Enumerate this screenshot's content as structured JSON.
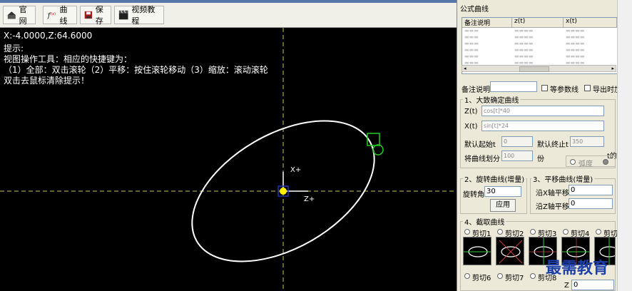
{
  "toolbar": {
    "home_label": "官网",
    "curve_label": "曲线",
    "save_label": "保存",
    "video_label": "视频教程"
  },
  "canvas": {
    "coords": "X:-4.0000,Z:64.6000",
    "hint_title": "提示:",
    "hint_line1": "视图操作工具：相应的快捷键为：",
    "hint_line2": "（1）全部：双击滚轮（2）平移：按住滚轮移动（3）缩放：滚动滚轮",
    "hint_line3": "双击去鼠标清除提示！",
    "axis_x_label": "X+",
    "axis_z_label": "Z+",
    "curve_color": "#ffffff",
    "axis_line_color": "#c8c864",
    "origin_color": "#ffee00",
    "marker_color": "#22cc22"
  },
  "panel": {
    "title": "公式曲线",
    "table_headers": [
      "备注说明",
      "z(t)",
      "x(t)"
    ],
    "remark_label": "备注说明",
    "param_label": "等参数线",
    "export_label": "导出时加",
    "group1_title": "1、大致确定曲线",
    "z_label": "Z(t)",
    "z_value": "cos[t]*40",
    "x_label": "X(t)",
    "x_value": "sin[t]*24",
    "start_label": "默认起始t",
    "start_value": "0",
    "end_label": "默认终止t",
    "end_value": "350",
    "divide_label": "将曲线划分",
    "divide_value": "100",
    "divide_unit": "份",
    "radian_label": "弧度",
    "t_label": "t的",
    "group2_title": "2、旋转曲线(增量)",
    "rotate_label": "旋转角",
    "rotate_value": "30",
    "apply_label": "应用",
    "group3_title": "3、平移曲线(增量)",
    "shift_x_label": "沿X轴平移",
    "shift_x_value": "0",
    "shift_z_label": "沿Z轴平移",
    "shift_z_value": "0",
    "group4_title": "4、截取曲线",
    "cut_labels": [
      "剪切1",
      "剪切2",
      "剪切3",
      "剪切4",
      "剪切"
    ],
    "cut_labels_row2": [
      "剪切6",
      "剪切7",
      "剪切8"
    ],
    "z_small_label": "Z",
    "z_small_value": "0"
  },
  "watermark": "最需教育"
}
